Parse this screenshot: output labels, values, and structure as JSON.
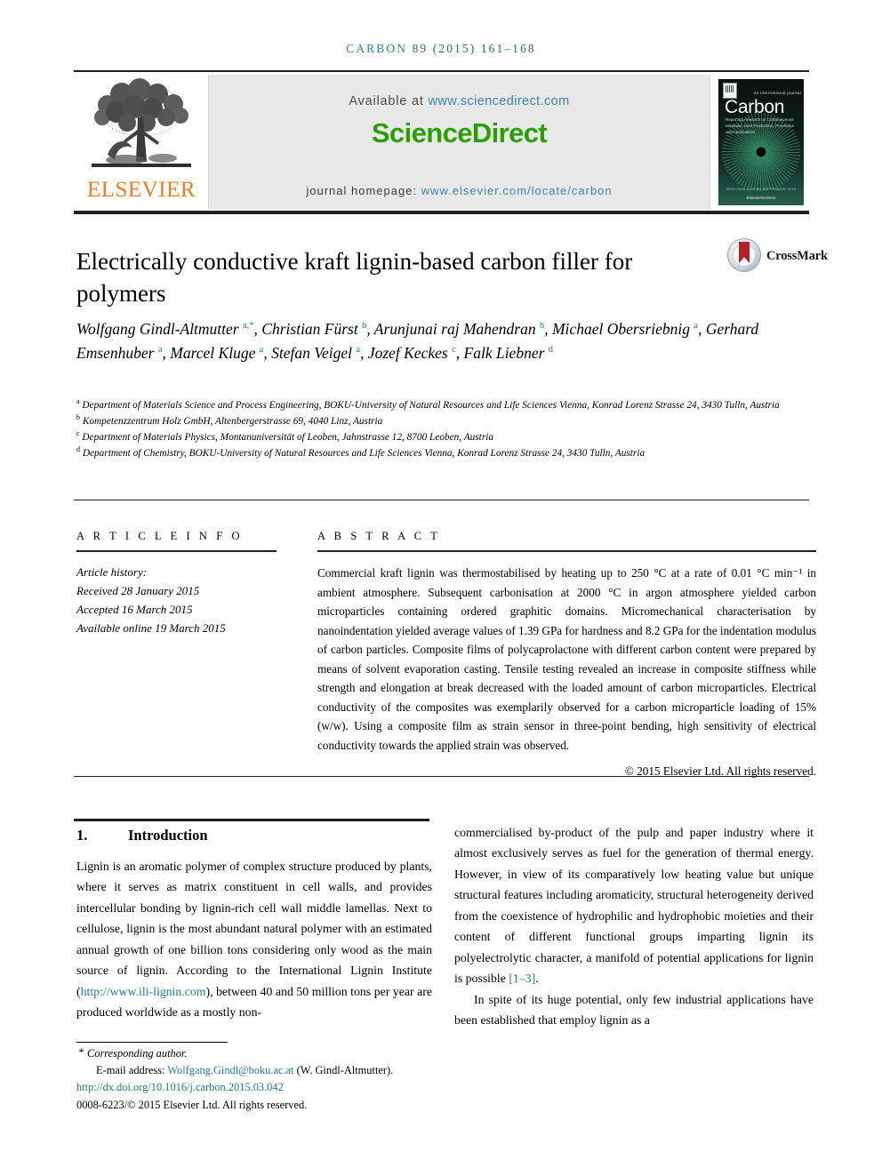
{
  "header": {
    "journal_name": "CARBON",
    "journal_ref": "89 (2015) 161–168",
    "available_at_label": "Available at",
    "available_at_url": "www.sciencedirect.com",
    "sciencedirect_logo": "ScienceDirect",
    "homepage_label": "journal homepage:",
    "homepage_url": "www.elsevier.com/locate/carbon",
    "publisher": "ELSEVIER",
    "cover": {
      "title": "Carbon",
      "tagline": "an international journal",
      "subtitle": "Reporting research on Carbonaceous Materials, their Production, Properties and Applications",
      "issn_line": "ISSN 0008-6223  89 SEPTEMBER 2015",
      "publisher": "ElsevierScience"
    }
  },
  "article": {
    "title": "Electrically conductive kraft lignin-based carbon filler for polymers",
    "crossmark_label": "CrossMark",
    "authors_html": "Wolfgang Gindl-Altmutter <sup>a,*</sup>, Christian Fürst <sup>b</sup>, Arunjunai raj Mahendran <sup>b</sup>, Michael Obersriebnig <sup>a</sup>, Gerhard Emsenhuber <sup>a</sup>, Marcel Kluge <sup>a</sup>, Stefan Veigel <sup>a</sup>, Jozef Keckes <sup>c</sup>, Falk Liebner <sup>d</sup>",
    "affiliations": [
      {
        "mark": "a",
        "text": "Department of Materials Science and Process Engineering, BOKU-University of Natural Resources and Life Sciences Vienna, Konrad Lorenz Strasse 24, 3430 Tulln, Austria"
      },
      {
        "mark": "b",
        "text": "Kompetenzzentrum Holz GmbH, Altenbergerstrasse 69, 4040 Linz, Austria"
      },
      {
        "mark": "c",
        "text": "Department of Materials Physics, Montanuniversität of Leoben, Jahnstrasse 12, 8700 Leoben, Austria"
      },
      {
        "mark": "d",
        "text": "Department of Chemistry, BOKU-University of Natural Resources and Life Sciences Vienna, Konrad Lorenz Strasse 24, 3430 Tulln, Austria"
      }
    ]
  },
  "article_info": {
    "label": "A R T I C L E   I N F O",
    "history_label": "Article history:",
    "received": "Received 28 January 2015",
    "accepted": "Accepted 16 March 2015",
    "available_online": "Available online 19 March 2015"
  },
  "abstract": {
    "label": "A B S T R A C T",
    "text": "Commercial kraft lignin was thermostabilised by heating up to 250 °C at a rate of 0.01 °C min⁻¹ in ambient atmosphere. Subsequent carbonisation at 2000 °C in argon atmosphere yielded carbon microparticles containing ordered graphitic domains. Micromechanical characterisation by nanoindentation yielded average values of 1.39 GPa for hardness and 8.2 GPa for the indentation modulus of carbon particles. Composite films of polycaprolactone with different carbon content were prepared by means of solvent evaporation casting. Tensile testing revealed an increase in composite stiffness while strength and elongation at break decreased with the loaded amount of carbon microparticles. Electrical conductivity of the composites was exemplarily observed for a carbon microparticle loading of 15% (w/w). Using a composite film as strain sensor in three-point bending, high sensitivity of electrical conductivity towards the applied strain was observed.",
    "copyright": "© 2015 Elsevier Ltd. All rights reserved."
  },
  "introduction": {
    "number": "1.",
    "heading": "Introduction",
    "left_column_pre_link": "Lignin is an aromatic polymer of complex structure produced by plants, where it serves as matrix constituent in cell walls, and provides intercellular bonding by lignin-rich cell wall middle lamellas. Next to cellulose, lignin is the most abundant natural polymer with an estimated annual growth of one billion tons considering only wood as the main source of lignin. According to the International Lignin Institute (",
    "left_column_link": "http://www.ili-lignin.com",
    "left_column_post_link": "), between 40 and 50 million tons per year are produced worldwide as a mostly non-",
    "right_column_para1_pre_cite": "commercialised by-product of the pulp and paper industry where it almost exclusively serves as fuel for the generation of thermal energy. However, in view of its comparatively low heating value but unique structural features including aromaticity, structural heterogeneity derived from the coexistence of hydrophilic and hydrophobic moieties and their content of different functional groups imparting lignin its polyelectrolytic character, a manifold of potential applications for lignin is possible ",
    "right_column_para1_cite": "[1–3]",
    "right_column_para1_post_cite": ".",
    "right_column_para2": "In spite of its huge potential, only few industrial applications have been established that employ lignin as a"
  },
  "footer": {
    "corresponding_star": "*",
    "corresponding_author": "Corresponding author.",
    "email_label": "E-mail address:",
    "email": "Wolfgang.Gindl@boku.ac.at",
    "email_owner": "(W. Gindl-Altmutter).",
    "doi": "http://dx.doi.org/10.1016/j.carbon.2015.03.042",
    "issn_copyright": "0008-6223/© 2015 Elsevier Ltd. All rights reserved."
  },
  "colors": {
    "link": "#1f7a9c",
    "elsevier_orange": "#ef7d1a",
    "sciencedirect_green": "#2aa000",
    "header_teal": "#2d7fa6",
    "crossmark_red": "#b62025"
  }
}
